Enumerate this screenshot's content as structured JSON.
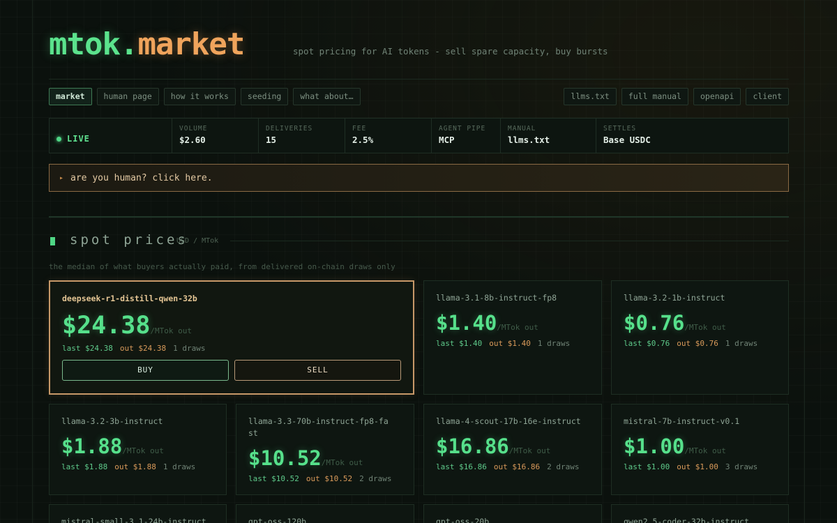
{
  "brand": {
    "part1": "mtok.",
    "part2": "market",
    "tagline": "spot pricing for AI tokens - sell spare capacity, buy bursts"
  },
  "nav": {
    "left": [
      "market",
      "human page",
      "how it works",
      "seeding",
      "what about…"
    ],
    "right": [
      "llms.txt",
      "full manual",
      "openapi",
      "client"
    ],
    "active": "market"
  },
  "stats": {
    "live": "LIVE",
    "items": [
      {
        "label": "VOLUME",
        "value": "$2.60"
      },
      {
        "label": "DELIVERIES",
        "value": "15"
      },
      {
        "label": "FEE",
        "value": "2.5%"
      },
      {
        "label": "AGENT PIPE",
        "value": "MCP"
      },
      {
        "label": "MANUAL",
        "value": "llms.txt"
      },
      {
        "label": "SETTLES",
        "value": "Base USDC"
      }
    ]
  },
  "banner": {
    "arrow": "▸",
    "text": "are you human? click here."
  },
  "section": {
    "title": "spot prices",
    "unit": "USD / MTok",
    "subtitle": "the median of what buyers actually paid, from delivered on-chain draws only"
  },
  "actions": {
    "buy": "BUY",
    "sell": "SELL"
  },
  "cards": [
    {
      "model": "deepseek-r1-distill-qwen-32b",
      "price": "$24.38",
      "per": "/MTok out",
      "last": "last $24.38",
      "out": "out $24.38",
      "draws": "1 draws"
    },
    {
      "model": "llama-3.1-8b-instruct-fp8",
      "price": "$1.40",
      "per": "/MTok out",
      "last": "last $1.40",
      "out": "out $1.40",
      "draws": "1 draws"
    },
    {
      "model": "llama-3.2-1b-instruct",
      "price": "$0.76",
      "per": "/MTok out",
      "last": "last $0.76",
      "out": "out $0.76",
      "draws": "1 draws"
    },
    {
      "model": "llama-3.2-3b-instruct",
      "price": "$1.88",
      "per": "/MTok out",
      "last": "last $1.88",
      "out": "out $1.88",
      "draws": "1 draws"
    },
    {
      "model": "llama-3.3-70b-instruct-fp8-fast",
      "price": "$10.52",
      "per": "/MTok out",
      "last": "last $10.52",
      "out": "out $10.52",
      "draws": "2 draws"
    },
    {
      "model": "llama-4-scout-17b-16e-instruct",
      "price": "$16.86",
      "per": "/MTok out",
      "last": "last $16.86",
      "out": "out $16.86",
      "draws": "2 draws"
    },
    {
      "model": "mistral-7b-instruct-v0.1",
      "price": "$1.00",
      "per": "/MTok out",
      "last": "last $1.00",
      "out": "out $1.00",
      "draws": "3 draws"
    },
    {
      "model": "mistral-small-3.1-24b-instruct",
      "price": "",
      "per": "",
      "last": "",
      "out": "",
      "draws": ""
    },
    {
      "model": "gpt-oss-120b",
      "price": "",
      "per": "",
      "last": "",
      "out": "",
      "draws": ""
    },
    {
      "model": "gpt-oss-20b",
      "price": "",
      "per": "",
      "last": "",
      "out": "",
      "draws": ""
    },
    {
      "model": "qwen2.5-coder-32b-instruct",
      "price": "",
      "per": "",
      "last": "",
      "out": "",
      "draws": ""
    }
  ]
}
